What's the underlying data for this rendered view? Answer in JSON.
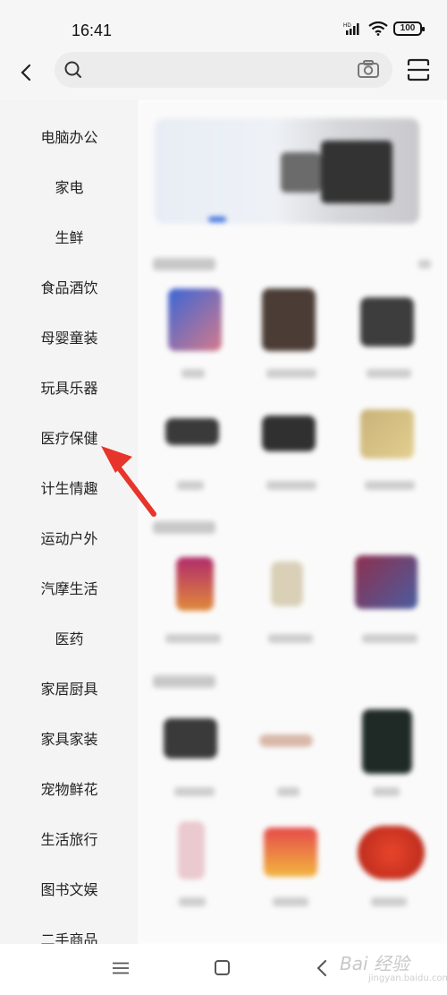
{
  "status_bar": {
    "time": "16:41",
    "battery": "100",
    "network_label": "HD"
  },
  "header": {
    "back_icon": "chevron-left-icon",
    "search_placeholder": "",
    "camera_icon": "camera-icon",
    "scan_icon": "scan-icon"
  },
  "sidebar": {
    "items": [
      {
        "label": "电脑办公"
      },
      {
        "label": "家电"
      },
      {
        "label": "生鲜"
      },
      {
        "label": "食品酒饮"
      },
      {
        "label": "母婴童装"
      },
      {
        "label": "玩具乐器"
      },
      {
        "label": "医疗保健"
      },
      {
        "label": "计生情趣"
      },
      {
        "label": "运动户外"
      },
      {
        "label": "汽摩生活"
      },
      {
        "label": "医药"
      },
      {
        "label": "家居厨具"
      },
      {
        "label": "家具家装"
      },
      {
        "label": "宠物鲜花"
      },
      {
        "label": "生活旅行"
      },
      {
        "label": "图书文娱"
      },
      {
        "label": "二手商品"
      }
    ]
  },
  "annotation": {
    "arrow_color": "#e8352b"
  },
  "watermark": {
    "text": "Bai 经验",
    "sub": "jingyan.baidu.com"
  },
  "colors": {
    "sidebar_bg": "#f4f4f4",
    "header_bg": "#f6f6f6",
    "accent": "#e8352b"
  }
}
